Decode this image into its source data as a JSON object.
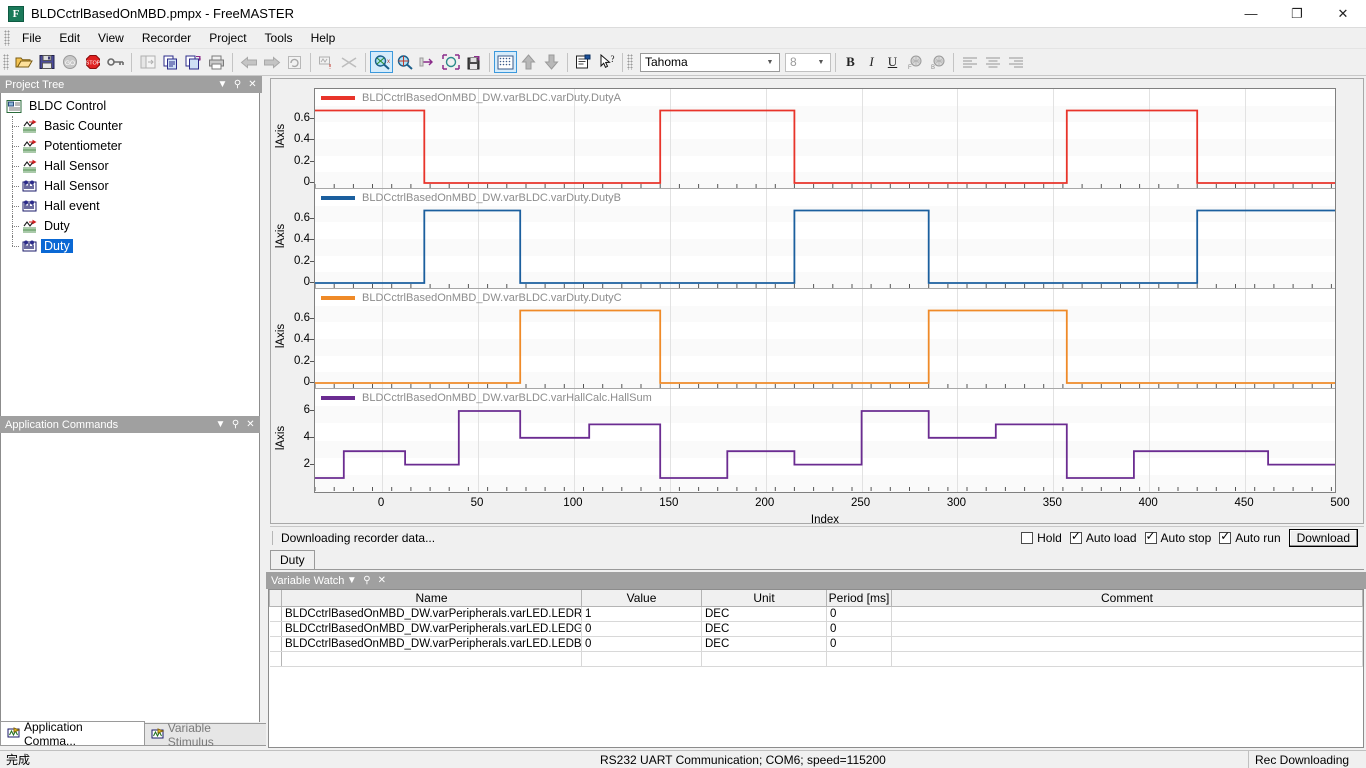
{
  "window": {
    "title": "BLDCctrlBasedOnMBD.pmpx - FreeMASTER",
    "icon_letter": "F",
    "minimize": "—",
    "maximize": "❐",
    "close": "✕"
  },
  "menu": {
    "items": [
      "File",
      "Edit",
      "View",
      "Recorder",
      "Project",
      "Tools",
      "Help"
    ]
  },
  "toolbar": {
    "font_name": "Tahoma",
    "font_size": "8",
    "bold": "B",
    "italic": "I",
    "underline": "U",
    "icons": [
      "open-folder-icon",
      "save-icon",
      "go-icon",
      "stop-icon",
      "key-icon",
      "layout-icon",
      "copy-icon",
      "copy-save-icon",
      "print-icon",
      "back-arrow-icon",
      "forward-arrow-icon",
      "refresh-icon",
      "stimulus-icon",
      "scissors-icon",
      "zoom-x-icon",
      "zoom-xy-icon",
      "zoom-fit-icon",
      "zoom-select-icon",
      "save-data-icon",
      "grid-icon",
      "move-up-icon",
      "move-down-icon",
      "properties-icon",
      "help-cursor-icon"
    ]
  },
  "sidebar": {
    "project_tree": {
      "title": "Project Tree",
      "collapse": "▼",
      "pin": "⚲",
      "close": "✕",
      "root": {
        "label": "BLDC Control",
        "icon": "project-icon"
      },
      "items": [
        {
          "label": "Basic Counter",
          "icon": "scope-icon"
        },
        {
          "label": "Potentiometer",
          "icon": "scope-icon"
        },
        {
          "label": "Hall Sensor",
          "icon": "scope-icon"
        },
        {
          "label": "Hall Sensor",
          "icon": "recorder-icon"
        },
        {
          "label": "Hall event",
          "icon": "recorder-icon"
        },
        {
          "label": "Duty",
          "icon": "scope-icon"
        },
        {
          "label": "Duty",
          "icon": "recorder-icon",
          "selected": true
        }
      ]
    },
    "application_commands": {
      "title": "Application Commands",
      "collapse": "▼",
      "pin": "⚲",
      "close": "✕"
    },
    "tabs": [
      {
        "label": "Application Comma...",
        "icon": "stimulus-icon",
        "active": true
      },
      {
        "label": "Variable Stimulus",
        "icon": "stimulus-icon",
        "active": false
      }
    ]
  },
  "scope": {
    "status_text": "Downloading recorder data...",
    "controls": {
      "hold": {
        "label": "Hold",
        "checked": false
      },
      "auto_load": {
        "label": "Auto load",
        "checked": true
      },
      "auto_stop": {
        "label": "Auto stop",
        "checked": true
      },
      "auto_run": {
        "label": "Auto run",
        "checked": true
      },
      "download_button": "Download"
    },
    "tabs": [
      {
        "label": "Duty",
        "active": true
      }
    ]
  },
  "chart_data": [
    {
      "type": "line",
      "title": "BLDCctrlBasedOnMBD_DW.varBLDC.varDuty.DutyA",
      "color": "#e8342a",
      "xlabel": "Index",
      "ylabel": "lAxis",
      "xlim": [
        -35,
        500
      ],
      "ylim": [
        0,
        0.75
      ],
      "yticks": [
        0,
        0.2,
        0.4,
        0.6
      ],
      "xticks": [
        0,
        50,
        100,
        150,
        200,
        250,
        300,
        350,
        400,
        450,
        500
      ],
      "grid": true,
      "x": [
        -35,
        -20,
        -20,
        22,
        22,
        22,
        72,
        72,
        145,
        145,
        215,
        215,
        285,
        285,
        357,
        357,
        425,
        425,
        498
      ],
      "y": [
        0.68,
        0.68,
        0.68,
        0.68,
        0.35,
        0,
        0,
        0,
        0,
        0.68,
        0.68,
        0,
        0,
        0,
        0,
        0.68,
        0.68,
        0,
        0
      ]
    },
    {
      "type": "line",
      "title": "BLDCctrlBasedOnMBD_DW.varBLDC.varDuty.DutyB",
      "color": "#1b5f9e",
      "ylabel": "lAxis",
      "ylim": [
        0,
        0.75
      ],
      "yticks": [
        0,
        0.2,
        0.4,
        0.6
      ],
      "grid": true,
      "x": [
        -35,
        22,
        22,
        72,
        72,
        145,
        145,
        215,
        215,
        285,
        285,
        357,
        357,
        425,
        425,
        498
      ],
      "y": [
        0,
        0,
        0.68,
        0.68,
        0,
        0,
        0,
        0,
        0.68,
        0.68,
        0,
        0,
        0,
        0,
        0.68,
        0.68
      ]
    },
    {
      "type": "line",
      "title": "BLDCctrlBasedOnMBD_DW.varBLDC.varDuty.DutyC",
      "color": "#ef8a28",
      "ylabel": "lAxis",
      "ylim": [
        0,
        0.75
      ],
      "yticks": [
        0,
        0.2,
        0.4,
        0.6
      ],
      "grid": true,
      "x": [
        -35,
        72,
        72,
        145,
        145,
        215,
        215,
        285,
        285,
        357,
        357,
        498
      ],
      "y": [
        0,
        0,
        0.68,
        0.68,
        0,
        0,
        0,
        0,
        0.68,
        0.68,
        0,
        0
      ]
    },
    {
      "type": "line",
      "title": "BLDCctrlBasedOnMBD_DW.varBLDC.varHallCalc.HallSum",
      "color": "#6b2c91",
      "ylabel": "lAxis",
      "ylim": [
        0.4,
        6.6
      ],
      "yticks": [
        2,
        4,
        6
      ],
      "grid": true,
      "x": [
        -35,
        -20,
        -20,
        12,
        12,
        40,
        40,
        72,
        72,
        108,
        108,
        145,
        145,
        180,
        180,
        215,
        215,
        250,
        250,
        285,
        285,
        320,
        320,
        357,
        357,
        392,
        392,
        425,
        425,
        462,
        462,
        498
      ],
      "y": [
        1,
        1,
        3,
        3,
        2,
        2,
        6,
        6,
        4,
        4,
        5,
        5,
        1,
        1,
        3,
        3,
        2,
        2,
        6,
        6,
        4,
        4,
        5,
        5,
        1,
        1,
        3,
        3,
        3,
        3,
        2,
        2
      ]
    }
  ],
  "variable_watch": {
    "title": "Variable Watch",
    "collapse": "▼",
    "pin": "⚲",
    "close": "✕",
    "columns": [
      "Name",
      "Value",
      "Unit",
      "Period [ms]",
      "Comment"
    ],
    "rows": [
      {
        "name": "BLDCctrlBasedOnMBD_DW.varPeripherals.varLED.LEDR",
        "value": "1",
        "unit": "DEC",
        "period": "0",
        "comment": ""
      },
      {
        "name": "BLDCctrlBasedOnMBD_DW.varPeripherals.varLED.LEDG",
        "value": "0",
        "unit": "DEC",
        "period": "0",
        "comment": ""
      },
      {
        "name": "BLDCctrlBasedOnMBD_DW.varPeripherals.varLED.LEDB",
        "value": "0",
        "unit": "DEC",
        "period": "0",
        "comment": ""
      }
    ]
  },
  "statusbar": {
    "left": "完成",
    "middle": "RS232 UART Communication; COM6; speed=115200",
    "right": "Rec Downloading"
  }
}
